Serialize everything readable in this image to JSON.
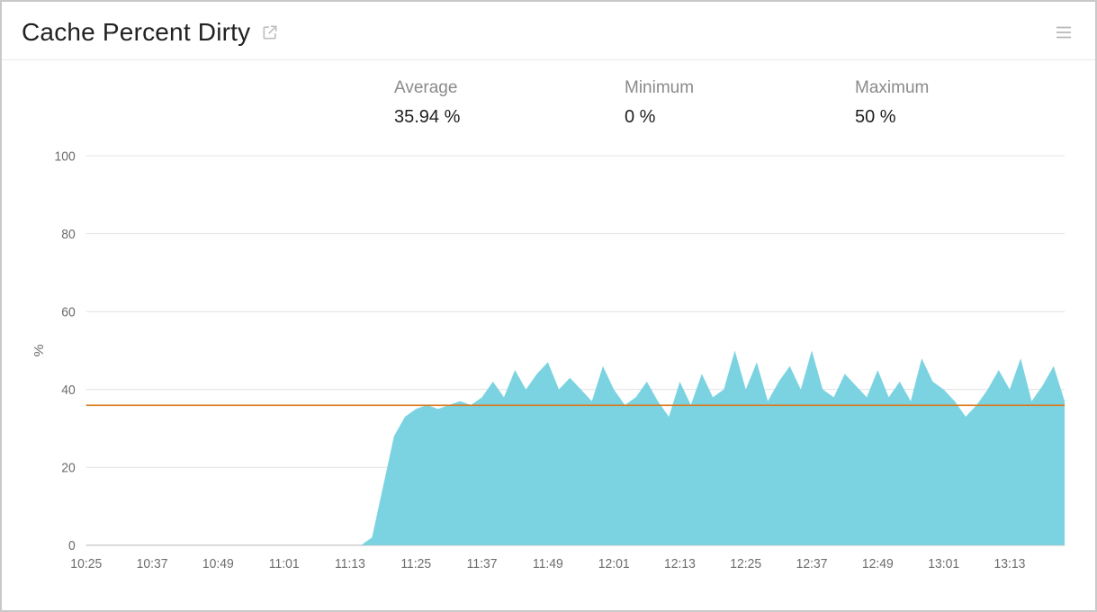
{
  "header": {
    "title": "Cache Percent Dirty"
  },
  "summary": {
    "average": {
      "label": "Average",
      "value": "35.94 %"
    },
    "minimum": {
      "label": "Minimum",
      "value": "0 %"
    },
    "maximum": {
      "label": "Maximum",
      "value": "50 %"
    }
  },
  "chart_data": {
    "type": "area",
    "title": "Cache Percent Dirty",
    "xlabel": "",
    "ylabel": "%",
    "ylim": [
      0,
      100
    ],
    "average_line": 35.94,
    "y_ticks": [
      0,
      20,
      40,
      60,
      80,
      100
    ],
    "x_tick_labels": [
      "10:25",
      "10:37",
      "10:49",
      "11:01",
      "11:13",
      "11:25",
      "11:37",
      "11:49",
      "12:01",
      "12:13",
      "12:25",
      "12:37",
      "12:49",
      "13:01",
      "13:13"
    ],
    "x": [
      "10:25",
      "10:27",
      "10:29",
      "10:31",
      "10:33",
      "10:35",
      "10:37",
      "10:39",
      "10:41",
      "10:43",
      "10:45",
      "10:47",
      "10:49",
      "10:51",
      "10:53",
      "10:55",
      "10:57",
      "10:59",
      "11:01",
      "11:03",
      "11:05",
      "11:07",
      "11:09",
      "11:11",
      "11:13",
      "11:15",
      "11:17",
      "11:19",
      "11:21",
      "11:23",
      "11:25",
      "11:27",
      "11:29",
      "11:31",
      "11:33",
      "11:35",
      "11:37",
      "11:39",
      "11:41",
      "11:43",
      "11:45",
      "11:47",
      "11:49",
      "11:51",
      "11:53",
      "11:55",
      "11:57",
      "11:59",
      "12:01",
      "12:03",
      "12:05",
      "12:07",
      "12:09",
      "12:11",
      "12:13",
      "12:15",
      "12:17",
      "12:19",
      "12:21",
      "12:23",
      "12:25",
      "12:27",
      "12:29",
      "12:31",
      "12:33",
      "12:35",
      "12:37",
      "12:39",
      "12:41",
      "12:43",
      "12:45",
      "12:47",
      "12:49",
      "12:51",
      "12:53",
      "12:55",
      "12:57",
      "12:59",
      "13:01",
      "13:03",
      "13:05",
      "13:07",
      "13:09",
      "13:11",
      "13:13",
      "13:15",
      "13:17",
      "13:19",
      "13:21",
      "13:23"
    ],
    "series": [
      {
        "name": "Cache Percent Dirty",
        "values": [
          0,
          0,
          0,
          0,
          0,
          0,
          0,
          0,
          0,
          0,
          0,
          0,
          0,
          0,
          0,
          0,
          0,
          0,
          0,
          0,
          0,
          0,
          0,
          0,
          0,
          0,
          2,
          15,
          28,
          33,
          35,
          36,
          35,
          36,
          37,
          36,
          38,
          42,
          38,
          45,
          40,
          44,
          47,
          40,
          43,
          40,
          37,
          46,
          40,
          36,
          38,
          42,
          37,
          33,
          42,
          36,
          44,
          38,
          40,
          50,
          40,
          47,
          37,
          42,
          46,
          40,
          50,
          40,
          38,
          44,
          41,
          38,
          45,
          38,
          42,
          37,
          48,
          42,
          40,
          37,
          33,
          36,
          40,
          45,
          40,
          48,
          37,
          41,
          46,
          37
        ]
      }
    ]
  }
}
